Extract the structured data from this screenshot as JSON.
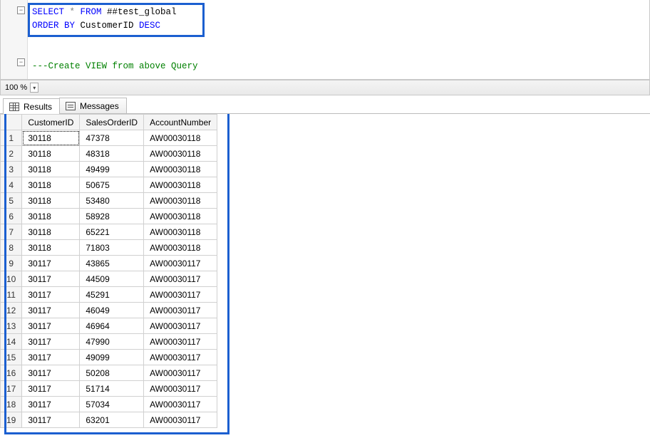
{
  "editor": {
    "line1": {
      "select": "SELECT",
      "star": " * ",
      "from": "FROM",
      "table": " ##test_global"
    },
    "line2": {
      "order": "ORDER",
      "by": " BY",
      "col": " CustomerID ",
      "desc": "DESC"
    },
    "line3_full": "---Create VIEW from above Query"
  },
  "zoom": {
    "value": "100 %"
  },
  "tabs": {
    "results": "Results",
    "messages": "Messages"
  },
  "columns": [
    "CustomerID",
    "SalesOrderID",
    "AccountNumber"
  ],
  "rows": [
    {
      "n": "1",
      "CustomerID": "30118",
      "SalesOrderID": "47378",
      "AccountNumber": "AW00030118"
    },
    {
      "n": "2",
      "CustomerID": "30118",
      "SalesOrderID": "48318",
      "AccountNumber": "AW00030118"
    },
    {
      "n": "3",
      "CustomerID": "30118",
      "SalesOrderID": "49499",
      "AccountNumber": "AW00030118"
    },
    {
      "n": "4",
      "CustomerID": "30118",
      "SalesOrderID": "50675",
      "AccountNumber": "AW00030118"
    },
    {
      "n": "5",
      "CustomerID": "30118",
      "SalesOrderID": "53480",
      "AccountNumber": "AW00030118"
    },
    {
      "n": "6",
      "CustomerID": "30118",
      "SalesOrderID": "58928",
      "AccountNumber": "AW00030118"
    },
    {
      "n": "7",
      "CustomerID": "30118",
      "SalesOrderID": "65221",
      "AccountNumber": "AW00030118"
    },
    {
      "n": "8",
      "CustomerID": "30118",
      "SalesOrderID": "71803",
      "AccountNumber": "AW00030118"
    },
    {
      "n": "9",
      "CustomerID": "30117",
      "SalesOrderID": "43865",
      "AccountNumber": "AW00030117"
    },
    {
      "n": "10",
      "CustomerID": "30117",
      "SalesOrderID": "44509",
      "AccountNumber": "AW00030117"
    },
    {
      "n": "11",
      "CustomerID": "30117",
      "SalesOrderID": "45291",
      "AccountNumber": "AW00030117"
    },
    {
      "n": "12",
      "CustomerID": "30117",
      "SalesOrderID": "46049",
      "AccountNumber": "AW00030117"
    },
    {
      "n": "13",
      "CustomerID": "30117",
      "SalesOrderID": "46964",
      "AccountNumber": "AW00030117"
    },
    {
      "n": "14",
      "CustomerID": "30117",
      "SalesOrderID": "47990",
      "AccountNumber": "AW00030117"
    },
    {
      "n": "15",
      "CustomerID": "30117",
      "SalesOrderID": "49099",
      "AccountNumber": "AW00030117"
    },
    {
      "n": "16",
      "CustomerID": "30117",
      "SalesOrderID": "50208",
      "AccountNumber": "AW00030117"
    },
    {
      "n": "17",
      "CustomerID": "30117",
      "SalesOrderID": "51714",
      "AccountNumber": "AW00030117"
    },
    {
      "n": "18",
      "CustomerID": "30117",
      "SalesOrderID": "57034",
      "AccountNumber": "AW00030117"
    },
    {
      "n": "19",
      "CustomerID": "30117",
      "SalesOrderID": "63201",
      "AccountNumber": "AW00030117"
    }
  ]
}
